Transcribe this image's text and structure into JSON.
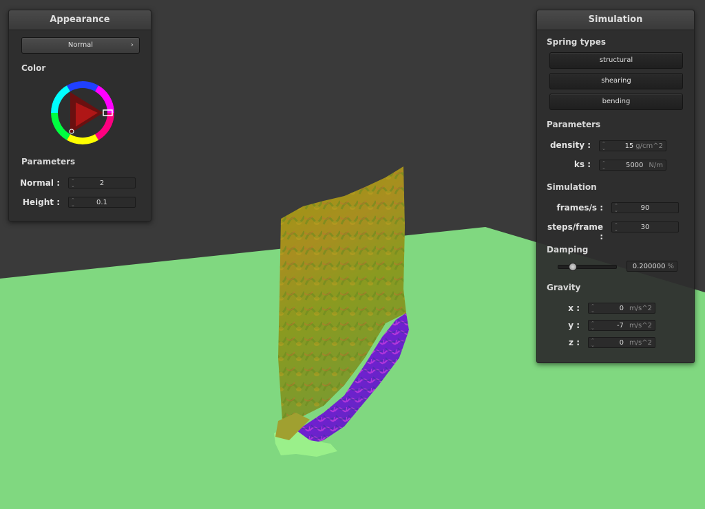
{
  "appearance": {
    "title": "Appearance",
    "shader_selected": "Normal",
    "color_label": "Color",
    "parameters_label": "Parameters",
    "normal_label": "Normal :",
    "normal_value": "2",
    "height_label": "Height :",
    "height_value": "0.1"
  },
  "simulation": {
    "title": "Simulation",
    "spring_types_label": "Spring types",
    "spring_buttons": [
      "structural",
      "shearing",
      "bending"
    ],
    "parameters_label": "Parameters",
    "density_label": "density :",
    "density_value": "15",
    "density_unit": "g/cm^2",
    "ks_label": "ks :",
    "ks_value": "5000",
    "ks_unit": "N/m",
    "simulation_label": "Simulation",
    "fps_label": "frames/s :",
    "fps_value": "90",
    "steps_label": "steps/frame :",
    "steps_value": "30",
    "damping_label": "Damping",
    "damping_value": "0.200000",
    "damping_unit": "%",
    "damping_fraction": 0.2,
    "gravity_label": "Gravity",
    "gx_label": "x :",
    "gx_value": "0",
    "gy_label": "y :",
    "gy_value": "-7",
    "gz_label": "z :",
    "gz_value": "0",
    "gravity_unit": "m/s^2"
  },
  "colors": {
    "background": "#3a3a3a",
    "ground": "#80d880",
    "panel": "#2e2e2e"
  },
  "icons": {
    "chevron": "chevron-right-icon",
    "spinner": "spinner-arrows-icon"
  }
}
